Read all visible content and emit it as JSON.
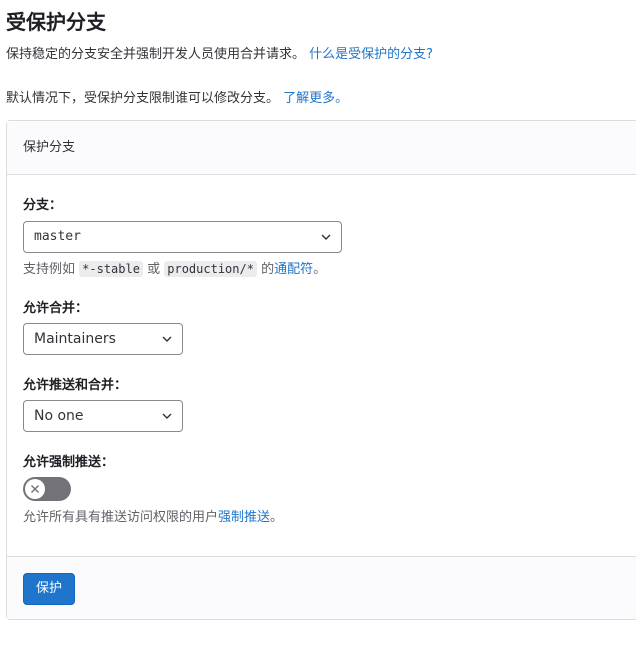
{
  "page": {
    "title": "受保护分支",
    "intro_text": "保持稳定的分支安全并强制开发人员使用合并请求。",
    "intro_link": "什么是受保护的分支?",
    "default_text": "默认情况下，受保护分支限制谁可以修改分支。",
    "default_link": "了解更多。"
  },
  "card": {
    "header": "保护分支",
    "branch": {
      "label": "分支：",
      "value": "master",
      "help_prefix": "支持例如",
      "example_1": "*-stable",
      "help_or": "或",
      "example_2": "production/*",
      "help_the": "的",
      "wildcard_link": "通配符",
      "help_end": "。"
    },
    "merge": {
      "label": "允许合并：",
      "value": "Maintainers"
    },
    "push_merge": {
      "label": "允许推送和合并：",
      "value": "No one"
    },
    "force_push": {
      "label": "允许强制推送：",
      "enabled": false,
      "help_prefix": "允许所有具有推送访问权限的用户",
      "help_link": "强制推送",
      "help_end": "。"
    },
    "submit_label": "保护"
  },
  "colors": {
    "link": "#1f75cb",
    "primary_button": "#1f75cb",
    "toggle_off": "#737278"
  }
}
